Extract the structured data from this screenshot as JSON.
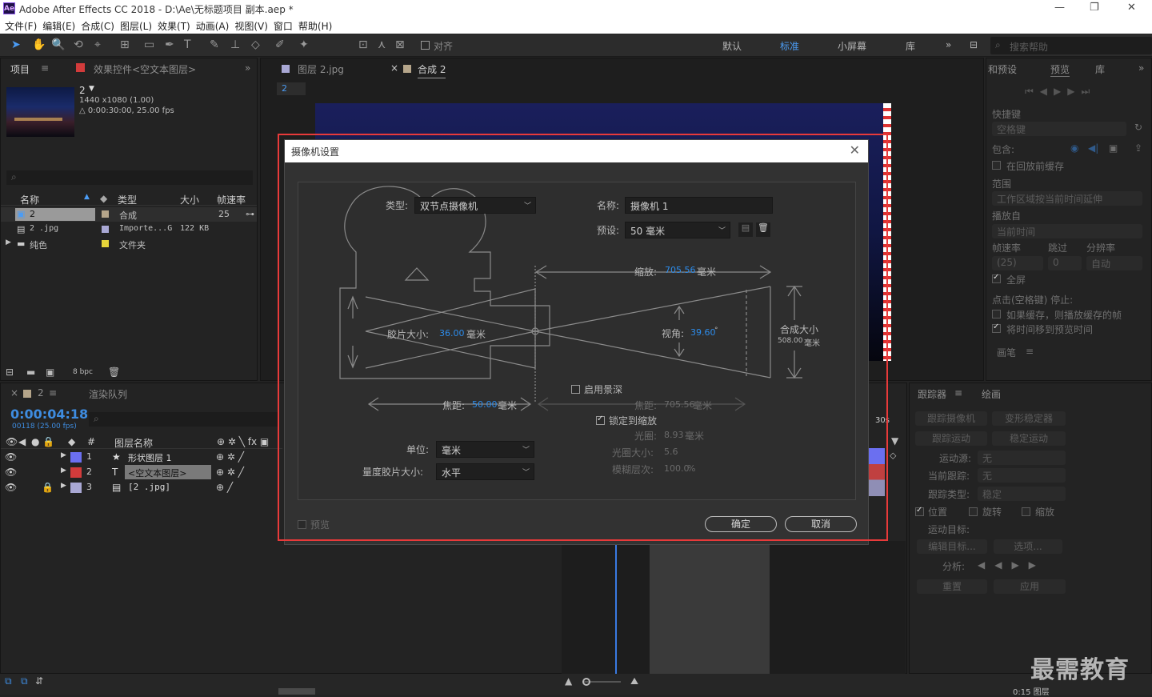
{
  "app": {
    "title": "Adobe After Effects CC 2018 - D:\\Ae\\无标题项目 副本.aep *",
    "logo": "Ae"
  },
  "menu": [
    "文件(F)",
    "编辑(E)",
    "合成(C)",
    "图层(L)",
    "效果(T)",
    "动画(A)",
    "视图(V)",
    "窗口",
    "帮助(H)"
  ],
  "toolbar": {
    "align_label": "对齐",
    "workspaces": [
      "默认",
      "标准",
      "小屏幕",
      "库"
    ],
    "active_workspace": "标准",
    "search_placeholder": "搜索帮助"
  },
  "project": {
    "tabs": [
      "项目",
      "效果控件<空文本图层>"
    ],
    "comp_name": "2",
    "comp_size": "1440 x1080 (1.00)",
    "comp_duration": "△ 0:00:30:00, 25.00 fps",
    "columns": [
      "名称",
      "类型",
      "大小",
      "帧速率"
    ],
    "rows": [
      {
        "name": "2",
        "type": "合成",
        "size": "",
        "fps": "25"
      },
      {
        "name": "2 .jpg",
        "type": "Importe...G",
        "size": "122 KB",
        "fps": ""
      },
      {
        "name": "纯色",
        "type": "文件夹",
        "size": "",
        "fps": ""
      }
    ],
    "bpc": "8 bpc"
  },
  "viewer": {
    "tabs": [
      "图层 2.jpg",
      "合成 2"
    ],
    "comp_tab_index": "2"
  },
  "timeline": {
    "tabs": [
      "2",
      "渲染队列"
    ],
    "timecode": "0:00:04:18",
    "frame_info": "00118 (25.00 fps)",
    "layer_col": "图层名称",
    "layers": [
      {
        "num": "1",
        "name": "形状图层 1",
        "color": "#6b6ff0"
      },
      {
        "num": "2",
        "name": "<空文本图层>",
        "color": "#d23b3b"
      },
      {
        "num": "3",
        "name": "[2 .jpg]",
        "color": "#a9a8d4"
      }
    ],
    "ruler_mark": "30s",
    "zoom_text": "0:15 图层"
  },
  "right_panel": {
    "tabs": [
      "预览",
      "库"
    ],
    "prev_label": "和预设",
    "shortcut_label": "快捷键",
    "shortcut_value": "空格键",
    "include_label": "包含:",
    "cache_label": "在回放前缓存",
    "range_label": "范围",
    "range_value": "工作区域按当前时间延伸",
    "play_from_label": "播放自",
    "play_from_value": "当前时间",
    "fps_label": "帧速率",
    "skip_label": "跳过",
    "res_label": "分辨率",
    "fps_value": "(25)",
    "skip_value": "0",
    "res_value": "自动",
    "fullscreen_label": "全屏",
    "stop_label": "点击(空格键) 停止:",
    "stop_opt1": "如果缓存，则播放缓存的帧",
    "stop_opt2": "将时间移到预览时间",
    "brush_label": "画笔"
  },
  "tracker": {
    "tabs": [
      "跟踪器",
      "绘画"
    ],
    "btn_track_camera": "跟踪摄像机",
    "btn_warp": "变形稳定器",
    "btn_track_motion": "跟踪运动",
    "btn_stabilize": "稳定运动",
    "source_label": "运动源:",
    "source_value": "无",
    "current_label": "当前跟踪:",
    "current_value": "无",
    "type_label": "跟踪类型:",
    "type_value": "稳定",
    "pos": "位置",
    "rot": "旋转",
    "scale": "缩放",
    "target_label": "运动目标:",
    "edit_target": "编辑目标...",
    "options": "选项...",
    "analyze_label": "分析:",
    "reset": "重置",
    "apply": "应用"
  },
  "dialog": {
    "title": "摄像机设置",
    "type_label": "类型:",
    "type_value": "双节点摄像机",
    "name_label": "名称:",
    "name_value": "摄像机 1",
    "preset_label": "预设:",
    "preset_value": "50 毫米",
    "zoom_label": "缩放:",
    "zoom_value": "705.56",
    "zoom_unit": "毫米",
    "film_label": "胶片大小:",
    "film_value": "36.00",
    "film_unit": "毫米",
    "angle_label": "视角:",
    "angle_value": "39.60",
    "angle_unit": "°",
    "comp_size_label": "合成大小",
    "comp_size_value": "508.00",
    "comp_size_unit": "毫米",
    "dof_label": "启用景深",
    "focal_label": "焦距:",
    "focal_value": "50.00",
    "focal_unit": "毫米",
    "focus_dist_label": "焦距:",
    "focus_dist_value": "705.56",
    "focus_dist_unit": "毫米",
    "lock_zoom_label": "锁定到缩放",
    "aperture_label": "光圈:",
    "aperture_value": "8.93",
    "aperture_unit": "毫米",
    "fstop_label": "光圈大小:",
    "fstop_value": "5.6",
    "blur_label": "模糊层次:",
    "blur_value": "100.0",
    "blur_unit": "%",
    "units_label": "单位:",
    "units_value": "毫米",
    "measure_label": "量度胶片大小:",
    "measure_value": "水平",
    "preview_label": "预览",
    "ok": "确定",
    "cancel": "取消"
  },
  "watermark": "最需教育"
}
